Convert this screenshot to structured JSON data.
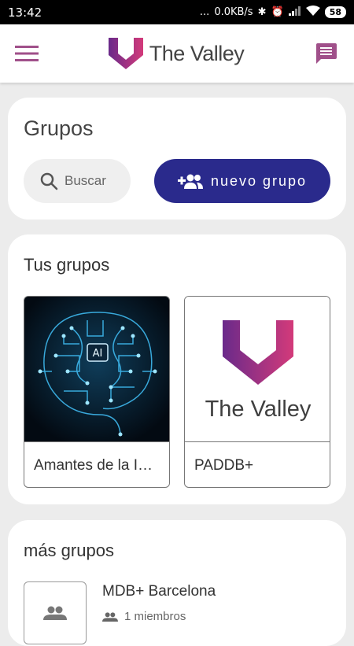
{
  "status_bar": {
    "time": "13:42",
    "dots": "...",
    "net_speed": "0.0KB/s",
    "battery": "58"
  },
  "header": {
    "brand_name": "The Valley",
    "menu_icon": "hamburger-icon",
    "chat_icon": "chat-icon",
    "brand_color": "#8a2b7a"
  },
  "groups_card": {
    "title": "Grupos",
    "search_placeholder": "Buscar",
    "new_group_label": "nuevo grupo"
  },
  "your_groups": {
    "title": "Tus grupos",
    "items": [
      {
        "name": "Amantes de la I…",
        "image": "ai-brain-circuit"
      },
      {
        "name": "PADDB+",
        "image": "the-valley-logo",
        "logo_text": "The Valley"
      }
    ]
  },
  "more_groups": {
    "title": "más grupos",
    "items": [
      {
        "name": "MDB+ Barcelona",
        "members": "1 miembros"
      }
    ]
  },
  "colors": {
    "accent": "#2a2a8c",
    "background": "#ececec",
    "logo_gradient_start": "#6a2a8a",
    "logo_gradient_end": "#d33a7a"
  }
}
